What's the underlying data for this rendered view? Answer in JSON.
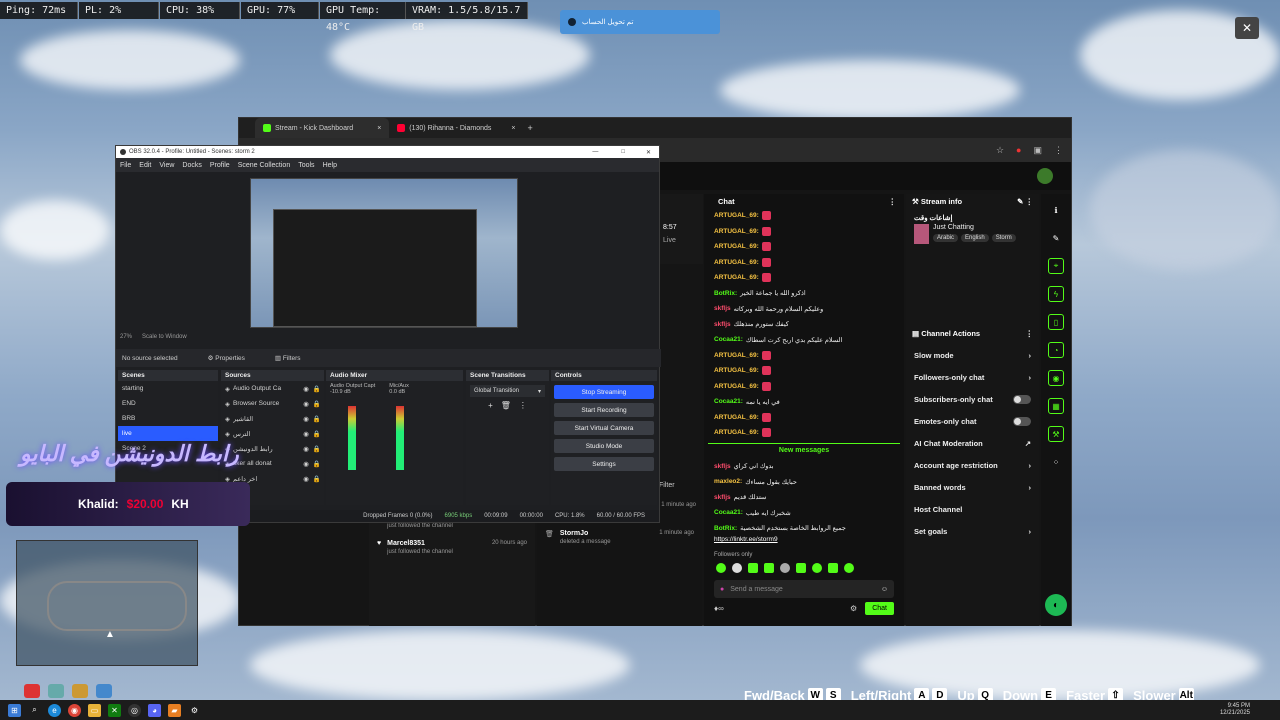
{
  "overlay": {
    "ping": "Ping: 72ms",
    "pl": "PL: 2%",
    "cpu": "CPU: 38%",
    "gpu": "GPU: 77%",
    "gpu_temp": "GPU Temp: 48°C",
    "vram": "VRAM: 1.5/5.8/15.7 GB"
  },
  "notification": {
    "text": "تم تحويل الحساب"
  },
  "browser": {
    "tabs": [
      {
        "label": "Stream - Kick Dashboard",
        "color": "#53fc18"
      },
      {
        "label": "(130) Rihanna - Diamonds",
        "color": "#ff0033"
      }
    ],
    "timer": "8:57",
    "live_label": "Live"
  },
  "obs": {
    "title": "OBS 32.0.4 - Profile: Untitled - Scenes: storm 2",
    "menu": [
      "File",
      "Edit",
      "View",
      "Docks",
      "Profile",
      "Scene Collection",
      "Tools",
      "Help"
    ],
    "zoom": "27%",
    "scale": "Scale to Window",
    "no_source": "No source selected",
    "properties": "Properties",
    "filters": "Filters",
    "scenes_title": "Scenes",
    "scenes": [
      "starting",
      "END",
      "BRB",
      "live",
      "Scene 2"
    ],
    "sources_title": "Sources",
    "sources": [
      "Audio Output Ca",
      "Browser Source",
      "القاشير",
      "الترس",
      "رابط الدونيشن",
      "tiker all donat",
      "اخر داعم"
    ],
    "mixer_title": "Audio Mixer",
    "mixer": [
      {
        "name": "Audio Output Capt",
        "db": "-10.9 dB"
      },
      {
        "name": "Mic/Aux",
        "db": "0.0 dB"
      }
    ],
    "transitions_title": "Scene Transitions",
    "transition": "Global Transition",
    "controls_title": "Controls",
    "stop_streaming": "Stop Streaming",
    "start_recording": "Start Recording",
    "virtual_camera": "Start Virtual Camera",
    "studio_mode": "Studio Mode",
    "settings": "Settings",
    "status": {
      "dropped": "Dropped Frames 0 (0.0%)",
      "kbps": "6905 kbps",
      "live_time": "00:09:09",
      "rec_time": "00:00:00",
      "cpu": "CPU: 1.8%",
      "fps": "60.00 / 60.00 FPS"
    }
  },
  "activity": {
    "filter": "Filter",
    "follows": [
      {
        "user": "maxleo2",
        "text": "just followed the channel",
        "time": "4 minutes ago"
      },
      {
        "user": "fatefaith",
        "text": "just followed the channel",
        "time": "5 minutes ago"
      },
      {
        "user": "Marcel8351",
        "text": "just followed the channel",
        "time": "20 hours ago"
      }
    ],
    "deleted": {
      "user": "StormJo",
      "text": "deleted a message",
      "time": "1 minute ago"
    },
    "earlier": "1 minute ago"
  },
  "chat": {
    "title": "Chat",
    "messages": [
      {
        "user": "ARTUGAL_69:",
        "text": "",
        "color": "#f6c343"
      },
      {
        "user": "ARTUGAL_69:",
        "text": "",
        "color": "#f6c343"
      },
      {
        "user": "ARTUGAL_69:",
        "text": "",
        "color": "#f6c343"
      },
      {
        "user": "ARTUGAL_69:",
        "text": "",
        "color": "#f6c343"
      },
      {
        "user": "ARTUGAL_69:",
        "text": "",
        "color": "#f6c343"
      },
      {
        "user": "BotRix:",
        "text": "اذكرو الله يا جماعة الخير",
        "color": "#53fc18"
      },
      {
        "user": "skfljs",
        "text": "وعليكم السلام ورحمة الله وبركاته",
        "color": "#ff4d6d"
      },
      {
        "user": "skfljs",
        "text": "كيفك ستورم منذهلك",
        "color": "#ff4d6d"
      },
      {
        "user": "Cocaa21:",
        "text": "السلام عليكم بدي اربح كرت اسطاك",
        "color": "#53fc18"
      },
      {
        "user": "ARTUGAL_69:",
        "text": "",
        "color": "#f6c343"
      },
      {
        "user": "ARTUGAL_69:",
        "text": "",
        "color": "#f6c343"
      },
      {
        "user": "ARTUGAL_69:",
        "text": "",
        "color": "#f6c343"
      },
      {
        "user": "Cocaa21:",
        "text": "في ايه يا نمه",
        "color": "#53fc18"
      },
      {
        "user": "ARTUGAL_69:",
        "text": "",
        "color": "#f6c343"
      },
      {
        "user": "ARTUGAL_69:",
        "text": "",
        "color": "#f6c343"
      }
    ],
    "new_messages": "New messages",
    "messages2": [
      {
        "user": "skfljs",
        "text": "بدوك اني كراي",
        "color": "#ff4d6d"
      },
      {
        "user": "maxleo2:",
        "text": "حبايك بقول مساءك",
        "color": "#f6c343"
      },
      {
        "user": "skfljs",
        "text": "ستدلك قديم",
        "color": "#ff4d6d"
      },
      {
        "user": "Cocaa21:",
        "text": "شخبرك ايه طيب",
        "color": "#53fc18"
      },
      {
        "user": "BotRix:",
        "text": "جميع الروابط الخاصة بستخدم الشخصية",
        "color": "#53fc18"
      }
    ],
    "link": "https://linktr.ee/storm9",
    "followers_only": "Followers only",
    "placeholder": "Send a message",
    "send": "Chat"
  },
  "stream_info": {
    "title": "Stream info",
    "stream_title": "إشاعات وقت",
    "category": "Just Chatting",
    "tags": [
      "Arabic",
      "English",
      "Storm"
    ]
  },
  "channel_actions": {
    "title": "Channel Actions",
    "items": [
      {
        "label": "Slow mode",
        "kind": "arrow"
      },
      {
        "label": "Followers-only chat",
        "kind": "arrow"
      },
      {
        "label": "Subscribers-only chat",
        "kind": "toggle"
      },
      {
        "label": "Emotes-only chat",
        "kind": "toggle"
      },
      {
        "label": "AI Chat Moderation",
        "kind": "ext"
      },
      {
        "label": "Account age restriction",
        "kind": "arrow"
      },
      {
        "label": "Banned words",
        "kind": "arrow"
      },
      {
        "label": "Host Channel",
        "kind": "none"
      },
      {
        "label": "Set goals",
        "kind": "arrow"
      }
    ]
  },
  "overlay_widgets": {
    "donation_title": "رابط الدونيشن في البايو",
    "donor": "Khalid:",
    "amount": "$20.00",
    "donor_next": "KH"
  },
  "game_hints": {
    "items": [
      {
        "label": "Fwd/Back",
        "keys": [
          "W",
          "S"
        ]
      },
      {
        "label": "Left/Right",
        "keys": [
          "A",
          "D"
        ]
      },
      {
        "label": "Up",
        "keys": [
          "Q"
        ]
      },
      {
        "label": "Down",
        "keys": [
          "E"
        ]
      },
      {
        "label": "Faster",
        "keys": [
          "⇧"
        ]
      },
      {
        "label": "Slower",
        "keys": [
          "Alt"
        ]
      }
    ]
  },
  "clock": {
    "time": "9:45 PM",
    "date": "12/21/2025"
  },
  "colors": {
    "kick_green": "#53fc18",
    "obs_blue": "#2a5cff"
  }
}
